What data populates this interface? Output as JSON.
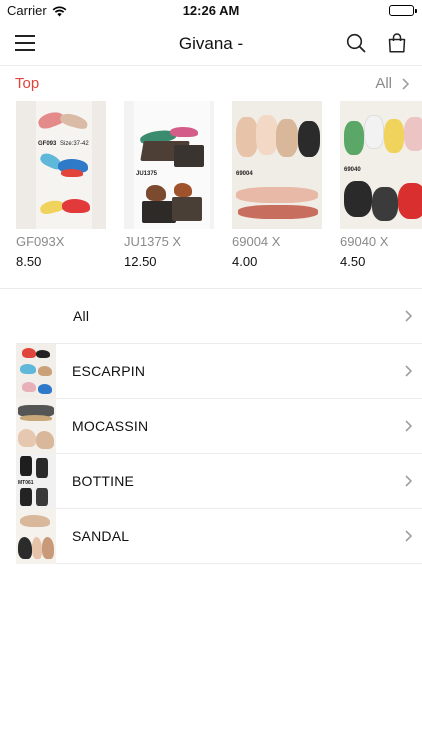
{
  "status_bar": {
    "carrier": "Carrier",
    "time": "12:26 AM"
  },
  "nav": {
    "title": "Givana -",
    "icons": [
      "menu-icon",
      "search-icon",
      "shopping-bag-icon"
    ]
  },
  "top_section": {
    "title": "Top",
    "all_label": "All",
    "products": [
      {
        "name": "GF093X",
        "price": "8.50",
        "photo_code": "GF093",
        "photo_note": "Size:37-42"
      },
      {
        "name": "JU1375 X",
        "price": "12.50",
        "photo_code": "JU1375",
        "photo_note": ""
      },
      {
        "name": "69004 X",
        "price": "4.00",
        "photo_code": "69004",
        "photo_note": ""
      },
      {
        "name": "69040 X",
        "price": "4.50",
        "photo_code": "69040",
        "photo_note": ""
      }
    ]
  },
  "categories": [
    {
      "label": "All",
      "has_thumb": false
    },
    {
      "label": "ESCARPIN",
      "has_thumb": true
    },
    {
      "label": "MOCASSIN",
      "has_thumb": true
    },
    {
      "label": "BOTTINE",
      "has_thumb": true,
      "photo_code": "MT061"
    },
    {
      "label": "SANDAL",
      "has_thumb": true
    }
  ],
  "colors": {
    "accent": "#e0443a",
    "muted": "#8a8a8a",
    "divider": "#eaeaea"
  }
}
